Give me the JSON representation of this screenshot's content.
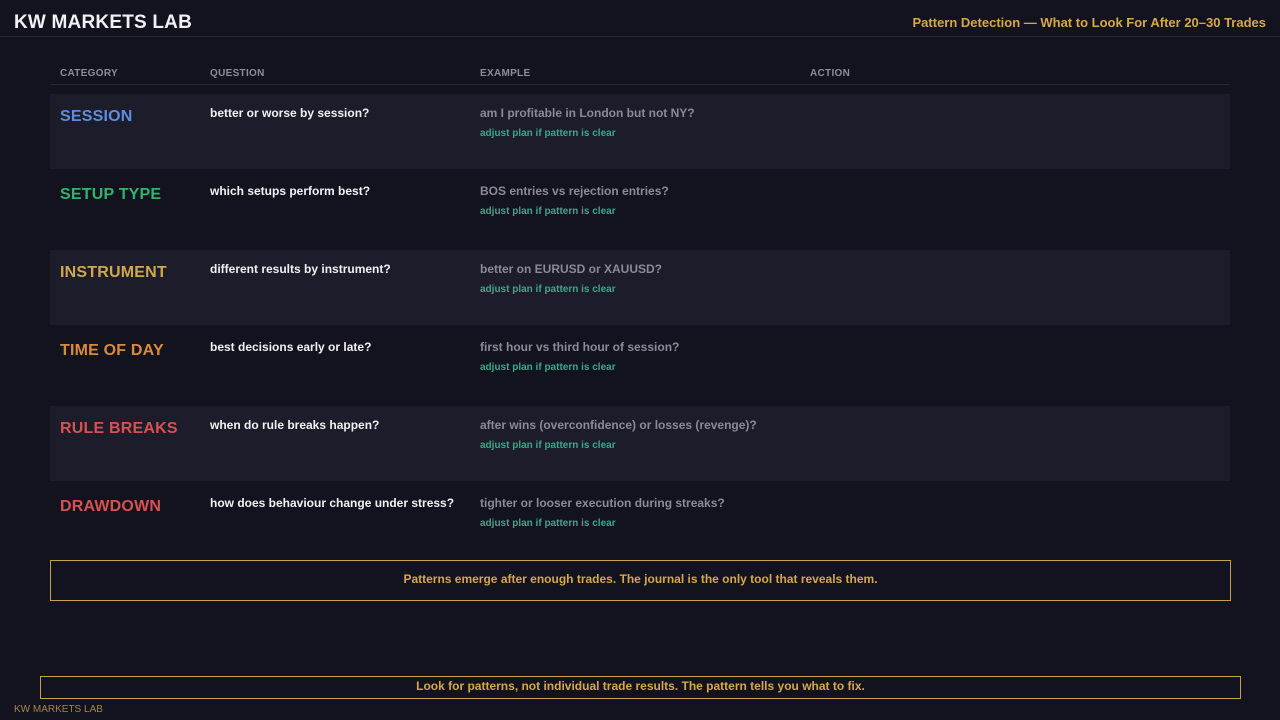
{
  "header": {
    "brand": "KW MARKETS LAB",
    "subtitle": "Pattern Detection — What to Look For After 20–30 Trades"
  },
  "columns": {
    "category": "CATEGORY",
    "question": "QUESTION",
    "example": "EXAMPLE",
    "action": "ACTION"
  },
  "rows": [
    {
      "category": "SESSION",
      "color": "#5b8ee0",
      "question": "better or worse by session?",
      "example": "am I profitable in London but not NY?",
      "action": "adjust plan if pattern is clear"
    },
    {
      "category": "SETUP TYPE",
      "color": "#33b36b",
      "question": "which setups perform best?",
      "example": "BOS entries vs rejection entries?",
      "action": "adjust plan if pattern is clear"
    },
    {
      "category": "INSTRUMENT",
      "color": "#d2a84a",
      "question": "different results by instrument?",
      "example": "better on EURUSD or XAUUSD?",
      "action": "adjust plan if pattern is clear"
    },
    {
      "category": "TIME OF DAY",
      "color": "#db8a38",
      "question": "best decisions early or late?",
      "example": "first hour vs third hour of session?",
      "action": "adjust plan if pattern is clear"
    },
    {
      "category": "RULE BREAKS",
      "color": "#d9514f",
      "question": "when do rule breaks happen?",
      "example": "after wins (overconfidence) or losses (revenge)?",
      "action": "adjust plan if pattern is clear"
    },
    {
      "category": "DRAWDOWN",
      "color": "#d9514f",
      "question": "how does behaviour change under stress?",
      "example": "tighter or looser execution during streaks?",
      "action": "adjust plan if pattern is clear"
    }
  ],
  "callout": "Patterns emerge after enough trades. The journal is the only tool that reveals them.",
  "footer": {
    "banner": "Look for patterns, not individual trade results. The pattern tells you what to fix.",
    "brand": "KW MARKETS LAB"
  }
}
